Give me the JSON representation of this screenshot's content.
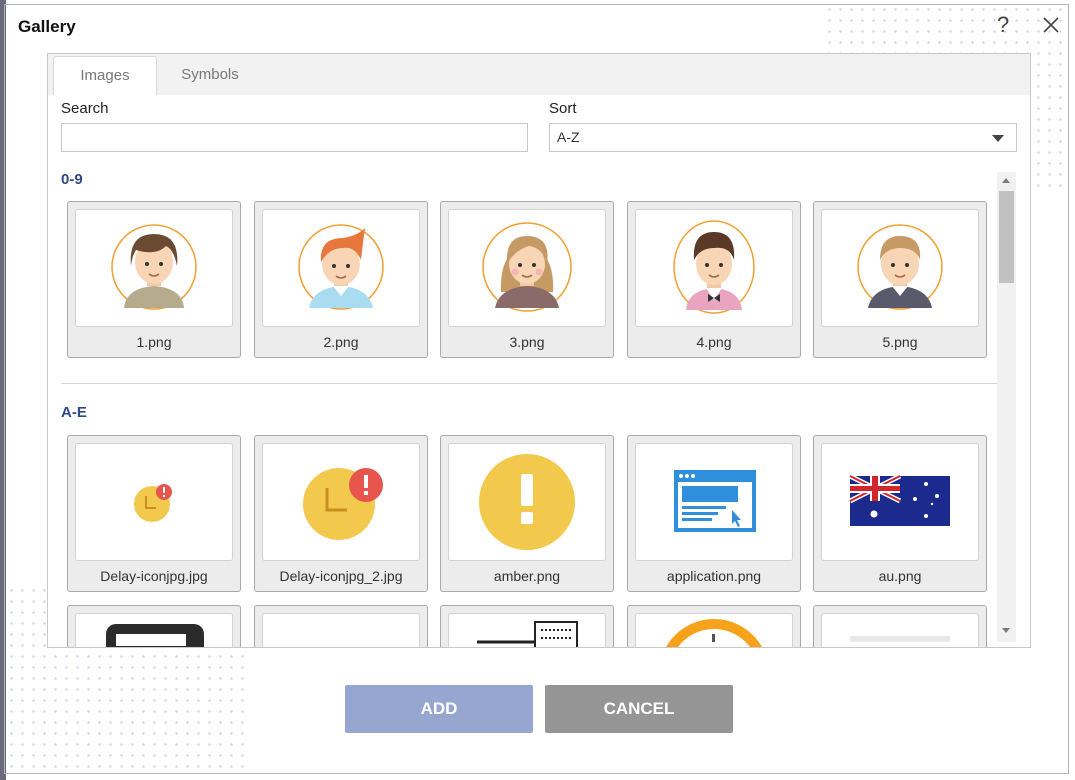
{
  "dialog": {
    "title": "Gallery",
    "help_icon": "question-icon",
    "close_icon": "close-icon"
  },
  "tabs": [
    {
      "label": "Images",
      "active": true
    },
    {
      "label": "Symbols",
      "active": false
    }
  ],
  "search": {
    "label": "Search",
    "value": "",
    "placeholder": ""
  },
  "sort": {
    "label": "Sort",
    "value": "A-Z"
  },
  "sections": [
    {
      "title": "0-9",
      "items": [
        "1.png",
        "2.png",
        "3.png",
        "4.png",
        "5.png"
      ]
    },
    {
      "title": "A-E",
      "items": [
        "Delay-iconjpg.jpg",
        "Delay-iconjpg_2.jpg",
        "amber.png",
        "application.png",
        "au.png"
      ]
    }
  ],
  "buttons": {
    "add": "ADD",
    "cancel": "CANCEL"
  },
  "colors": {
    "accent": "#2f4a8a",
    "add_button": "#97a6d1",
    "cancel_button": "#959595",
    "avatar_ring": "#f0a030",
    "clock": "#f2c94c",
    "alert": "#e8554e",
    "app_blue": "#2f8fdd"
  }
}
